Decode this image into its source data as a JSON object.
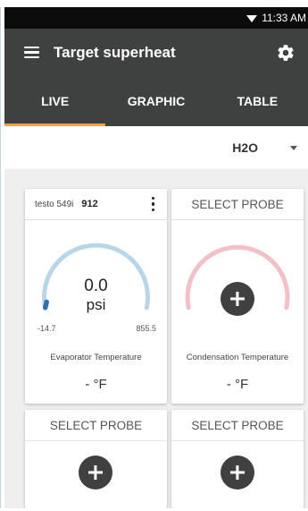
{
  "status_bar": {
    "time": "11:33 AM",
    "wifi_icon": "wifi-icon"
  },
  "app_bar": {
    "title": "Target superheat",
    "menu_icon": "menu-icon",
    "settings_icon": "gear-icon"
  },
  "tabs": [
    {
      "label": "LIVE",
      "active": true
    },
    {
      "label": "GRAPHIC",
      "active": false
    },
    {
      "label": "TABLE",
      "active": false
    }
  ],
  "medium": {
    "selected": "H2O"
  },
  "cards": {
    "evaporator": {
      "probe_name": "testo 549i",
      "probe_serial": "912",
      "value": "0.0",
      "unit": "psi",
      "range_min": "-14.7",
      "range_max": "855.5",
      "level_fraction": 0.0,
      "label": "Evaporator Temperature",
      "reading": "- °F"
    },
    "condensation": {
      "header": "SELECT PROBE",
      "label": "Condensation Temperature",
      "reading": "- °F"
    },
    "slot3": {
      "header": "SELECT PROBE"
    },
    "slot4": {
      "header": "SELECT PROBE"
    }
  },
  "colors": {
    "app_bar": "#3f4040",
    "tab_indicator": "#f2a23a",
    "gauge_evaporator": "#b9d5ea",
    "gauge_evaporator_needle": "#2f6fb3",
    "gauge_condensation": "#f3c0c8"
  }
}
